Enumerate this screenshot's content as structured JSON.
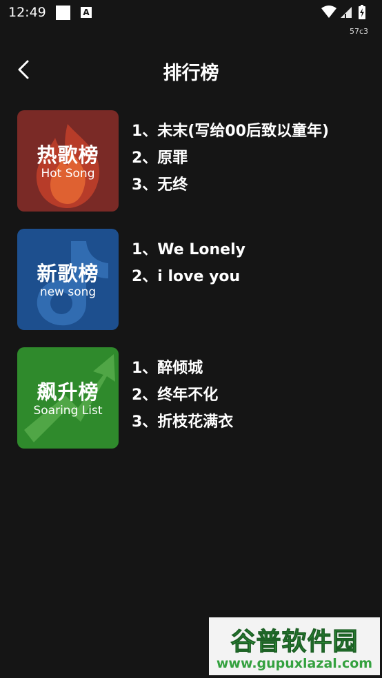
{
  "status_bar": {
    "time": "12:49",
    "build_id": "57c3",
    "notification_icons": [
      "square-notification-icon",
      "a-notification-icon"
    ],
    "system_icons": [
      "wifi-icon",
      "signal-icon",
      "battery-icon"
    ]
  },
  "header": {
    "title": "排行榜",
    "back_icon": "chevron-left-icon"
  },
  "rank_lists": [
    {
      "cover_title": "热歌榜",
      "cover_subtitle": "Hot Song",
      "cover_color": "#7a2a26",
      "songs": [
        "1、未末(写给00后致以童年)",
        "2、原罪",
        "3、无终"
      ]
    },
    {
      "cover_title": "新歌榜",
      "cover_subtitle": "new song",
      "cover_color": "#1d4f8e",
      "songs": [
        "1、We Lonely",
        "2、i love you"
      ]
    },
    {
      "cover_title": "飙升榜",
      "cover_subtitle": "Soaring List",
      "cover_color": "#2f8a2c",
      "songs": [
        "1、醉倾城",
        "2、终年不化",
        "3、折枝花满衣"
      ]
    }
  ],
  "watermark": {
    "text": "谷普软件园",
    "url": "www.gupuxlazal.com"
  }
}
